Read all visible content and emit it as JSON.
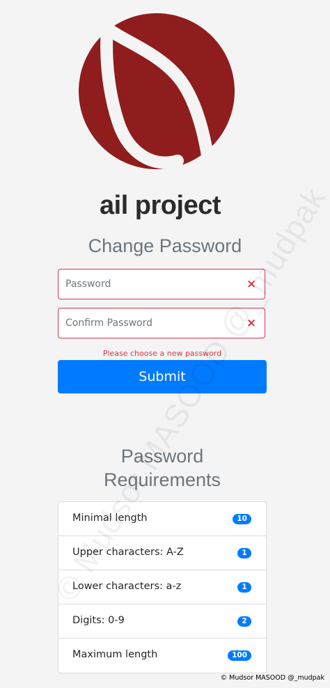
{
  "logo": {
    "text": "ail project",
    "brand_color": "#8f1d1d"
  },
  "form": {
    "title": "Change Password",
    "password_placeholder": "Password",
    "confirm_placeholder": "Confirm Password",
    "error_icon": "×",
    "error_message": "Please choose a new password",
    "submit_label": "Submit",
    "accent_color": "#007bff",
    "error_color": "#dc3545"
  },
  "requirements": {
    "title_line1": "Password",
    "title_line2": "Requirements",
    "items": [
      {
        "label": "Minimal length",
        "value": "10"
      },
      {
        "label": "Upper characters: A-Z",
        "value": "1"
      },
      {
        "label": "Lower characters: a-z",
        "value": "1"
      },
      {
        "label": "Digits: 0-9",
        "value": "2"
      },
      {
        "label": "Maximum length",
        "value": "100"
      }
    ]
  },
  "watermark": "© Mudsor MASOOD @_mudpak",
  "footer": "© Mudsor MASOOD @_mudpak"
}
